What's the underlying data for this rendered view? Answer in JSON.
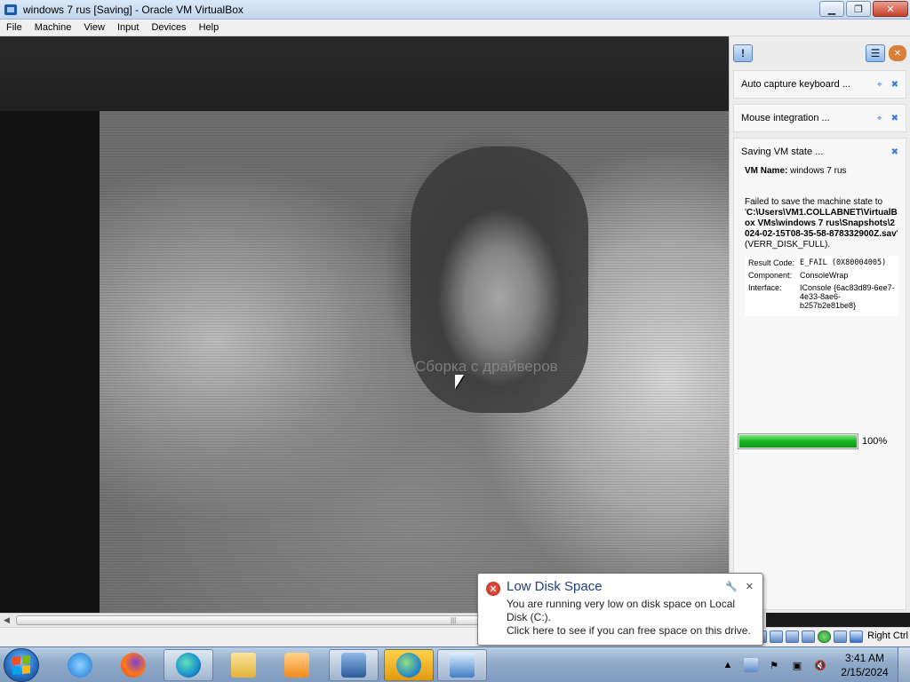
{
  "window": {
    "title": "windows 7 rus [Saving] - Oracle VM VirtualBox",
    "minimize": "▁",
    "maximize": "❐",
    "close": "✕"
  },
  "menu": [
    "File",
    "Machine",
    "View",
    "Input",
    "Devices",
    "Help"
  ],
  "guest": {
    "watermark": "Сборка с драйверов"
  },
  "notifications": {
    "cards": [
      {
        "label": "Auto capture keyboard ..."
      },
      {
        "label": "Mouse integration ..."
      }
    ],
    "saving": {
      "title": "Saving VM state ...",
      "vm_name_label": "VM Name:",
      "vm_name": "windows 7 rus",
      "error_prefix": "Failed to save the machine state to '",
      "error_path": "C:\\Users\\VM1.COLLABNET\\VirtualBox VMs\\windows 7 rus\\Snapshots\\2024-02-15T08-35-58-878332900Z.sav",
      "error_suffix": "' (VERR_DISK_FULL).",
      "result_code_label": "Result Code:",
      "result_code": "E_FAIL (0X80004005)",
      "component_label": "Component:",
      "component": "ConsoleWrap",
      "interface_label": "Interface:",
      "interface": "IConsole {6ac83d89-6ee7-4e33-8ae6-b257b2e81be8}",
      "progress_percent": 100,
      "progress_text": "100%"
    }
  },
  "statusbar": {
    "host_key": "Right Ctrl"
  },
  "balloon": {
    "title": "Low Disk Space",
    "line1": "You are running very low on disk space on Local Disk (C:).",
    "line2": "Click here to see if you can free space on this drive."
  },
  "clock": {
    "time": "3:41 AM",
    "date": "2/15/2024"
  },
  "colors": {
    "accent": "#3a7bd5",
    "progress": "#18b41f",
    "error": "#b81b0c"
  }
}
